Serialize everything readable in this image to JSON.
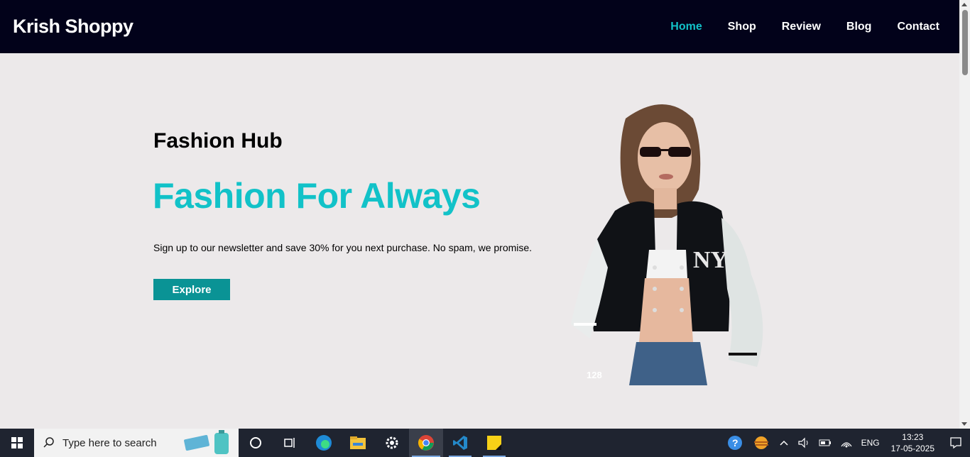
{
  "site": {
    "brand": "Krish Shoppy",
    "nav": [
      {
        "label": "Home",
        "active": true
      },
      {
        "label": "Shop",
        "active": false
      },
      {
        "label": "Review",
        "active": false
      },
      {
        "label": "Blog",
        "active": false
      },
      {
        "label": "Contact",
        "active": false
      }
    ],
    "accent_color": "#12c2c8",
    "header_bg": "#02021a",
    "button_color": "#0a9395"
  },
  "hero": {
    "subtitle": "Fashion Hub",
    "title": "Fashion For Always",
    "text": "Sign up to our newsletter and save 30% for you next purchase. No spam, we promise.",
    "button_label": "Explore",
    "image_badge": "128",
    "image_icon": "model-wearing-ny-varsity-jacket"
  },
  "taskbar": {
    "search_placeholder": "Type here to search",
    "apps": [
      "start-icon",
      "cortana-icon",
      "task-view-icon",
      "edge-icon",
      "file-explorer-icon",
      "settings-icon",
      "chrome-icon",
      "vscode-icon",
      "sticky-notes-icon"
    ],
    "language": "ENG",
    "time": "13:23",
    "date": "17-05-2025"
  }
}
